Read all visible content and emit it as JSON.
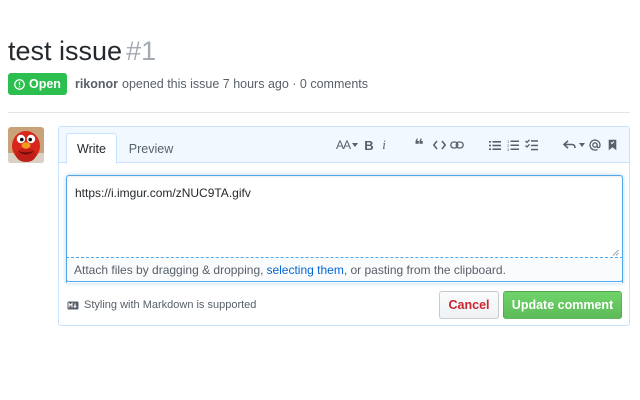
{
  "issue": {
    "title": "test issue",
    "number": "#1",
    "state": "Open",
    "state_icon": "issue-opened-icon",
    "author": "rikonor",
    "opened_text": "opened this issue 7 hours ago · 0 comments"
  },
  "comment": {
    "avatar_icon": "elmo-avatar",
    "tabs": [
      {
        "label": "Write",
        "active": true
      },
      {
        "label": "Preview",
        "active": false
      }
    ],
    "toolbar": {
      "header": "AA",
      "bold": "B",
      "italic": "i",
      "quote": "❝",
      "icons": [
        "header-icon",
        "bold-icon",
        "italic-icon",
        "quote-icon",
        "code-icon",
        "link-icon",
        "unordered-list-icon",
        "ordered-list-icon",
        "task-list-icon",
        "reply-icon",
        "mention-icon",
        "bookmark-icon"
      ]
    },
    "body_value": "https://i.imgur.com/zNUC9TA.gifv",
    "attach_prefix": "Attach files by dragging & dropping,",
    "attach_link": "selecting them",
    "attach_suffix": ", or pasting from the clipboard.",
    "markdown_hint": "Styling with Markdown is supported",
    "cancel_label": "Cancel",
    "update_label": "Update comment"
  },
  "colors": {
    "open_green": "#2cbe4e",
    "update_green": "#5dbb58",
    "cancel_red": "#cb2431",
    "link_blue": "#0366d6",
    "focus_blue": "#51a7e8"
  }
}
